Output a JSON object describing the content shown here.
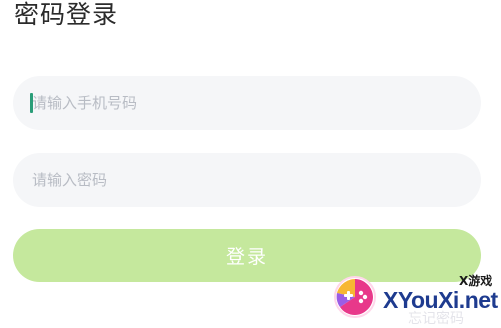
{
  "header": {
    "title": "密码登录"
  },
  "form": {
    "phone_placeholder": "请输入手机号码",
    "password_placeholder": "请输入密码",
    "login_label": "登录"
  },
  "footer": {
    "faded_link": "忘记密码"
  },
  "watermark": {
    "small_text": "X游戏",
    "brand": "XYouXi.net"
  },
  "colors": {
    "button_bg": "#c5e89d",
    "field_bg": "#f5f6f8",
    "caret": "#2a9d78",
    "brand_blue": "#1e3b8f"
  },
  "icons": {
    "watermark_logo": "gamepad-icon"
  }
}
